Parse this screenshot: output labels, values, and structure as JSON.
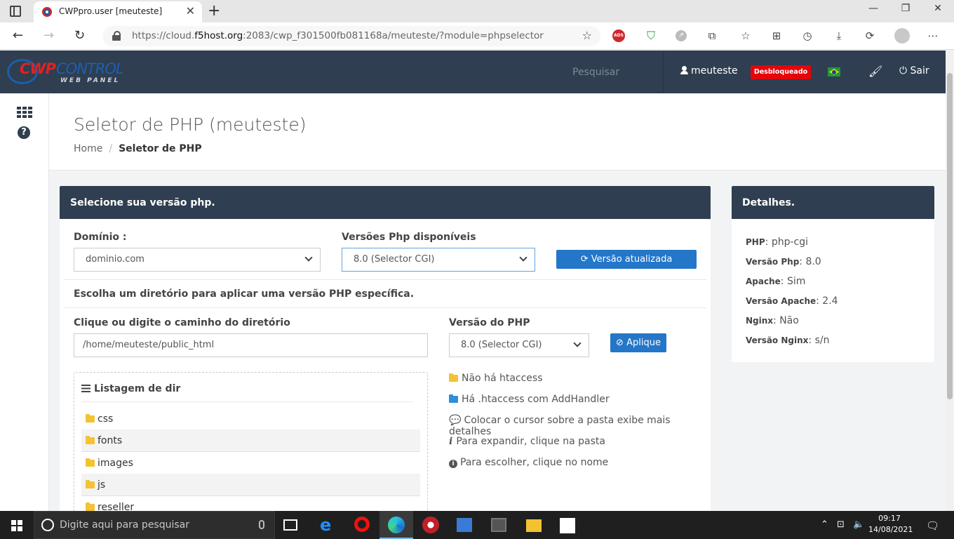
{
  "browser": {
    "tab_title": "CWPpro.user [meuteste]",
    "url_host": "https://cloud.",
    "url_domain": "f5host.org",
    "url_rest": ":2083/cwp_f301500fb081168a/meuteste/?module=phpselector",
    "ads_label": "ADS"
  },
  "header": {
    "logo_cwp": "CWP",
    "logo_control": "CONTROL",
    "logo_webpanel": "WEB PANEL",
    "search_label": "Pesquisar",
    "username": "meuteste",
    "status_badge": "Desbloqueado",
    "logout_label": "Sair"
  },
  "page": {
    "title": "Seletor de PHP (meuteste)",
    "breadcrumb_home": "Home",
    "breadcrumb_sep": "/",
    "breadcrumb_current": "Seletor de PHP"
  },
  "main_panel": {
    "heading": "Selecione sua versão php.",
    "domain_label": "Domínio :",
    "domain_value": "dominio.com",
    "versions_label": "Versões Php disponíveis",
    "versions_value": "8.0 (Selector CGI)",
    "update_button": "Versão atualizada",
    "dir_instruction": "Escolha um diretório para aplicar uma versão PHP específica.",
    "path_label": "Clique ou digite o caminho do diretório",
    "path_value": "/home/meuteste/public_html",
    "php_version_label": "Versão do PHP",
    "php_version_value": "8.0 (Selector CGI)",
    "apply_button": "Aplique",
    "dir_list_title": "Listagem de dir",
    "dirs": [
      "css",
      "fonts",
      "images",
      "js",
      "reseller"
    ],
    "legend": {
      "no_htaccess": "Não há htaccess",
      "has_htaccess": "Há .htaccess com AddHandler",
      "hover_hint": "Colocar o cursor sobre a pasta exibe mais detalhes",
      "expand_hint": "Para expandir, clique na pasta",
      "choose_hint": "Para escolher, clique no nome"
    }
  },
  "details_panel": {
    "heading": "Detalhes.",
    "rows": [
      {
        "label": "PHP",
        "value": "php-cgi"
      },
      {
        "label": "Versão Php",
        "value": "8.0"
      },
      {
        "label": "Apache",
        "value": "Sim"
      },
      {
        "label": "Versão Apache",
        "value": "2.4"
      },
      {
        "label": "Nginx",
        "value": "Não"
      },
      {
        "label": "Versão Nginx",
        "value": "s/n"
      }
    ]
  },
  "taskbar": {
    "search_placeholder": "Digite aqui para pesquisar",
    "time": "09:17",
    "date": "14/08/2021"
  },
  "colors": {
    "header_bg": "#2f3e50",
    "primary_button": "#2476c8",
    "badge_red": "#e4050b",
    "folder_yellow": "#f4c233",
    "folder_blue": "#2f8fd8"
  }
}
